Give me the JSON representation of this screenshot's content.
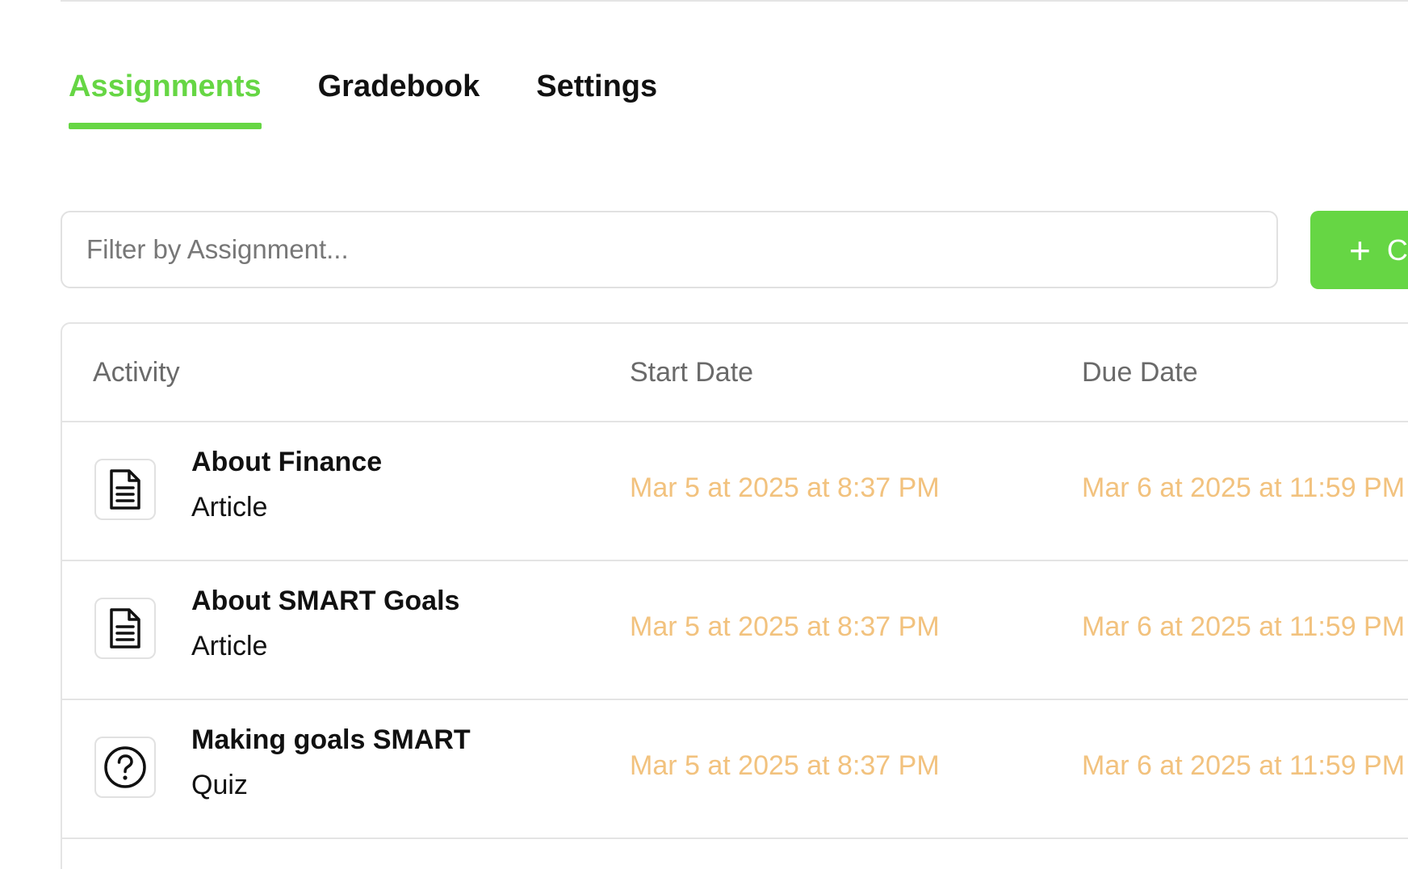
{
  "tabs": [
    {
      "label": "Assignments",
      "active": true
    },
    {
      "label": "Gradebook",
      "active": false
    },
    {
      "label": "Settings",
      "active": false
    }
  ],
  "filter": {
    "placeholder": "Filter by Assignment...",
    "value": ""
  },
  "create_button": {
    "icon": "plus-icon",
    "label": "C"
  },
  "table": {
    "columns": {
      "activity": "Activity",
      "start_date": "Start Date",
      "due_date": "Due Date"
    },
    "rows": [
      {
        "icon": "document-icon",
        "title": "About Finance",
        "type": "Article",
        "start_date": "Mar 5 at 2025 at 8:37 PM",
        "due_date": "Mar 6 at 2025 at 11:59 PM"
      },
      {
        "icon": "document-icon",
        "title": "About SMART Goals",
        "type": "Article",
        "start_date": "Mar 5 at 2025 at 8:37 PM",
        "due_date": "Mar 6 at 2025 at 11:59 PM"
      },
      {
        "icon": "question-circle-icon",
        "title": "Making goals SMART",
        "type": "Quiz",
        "start_date": "Mar 5 at 2025 at 8:37 PM",
        "due_date": "Mar 6 at 2025 at 11:59 PM"
      }
    ]
  },
  "colors": {
    "accent": "#66d644",
    "date_text": "#f2c27e",
    "border": "#e4e4e4",
    "header_text": "#6a6a6a"
  }
}
